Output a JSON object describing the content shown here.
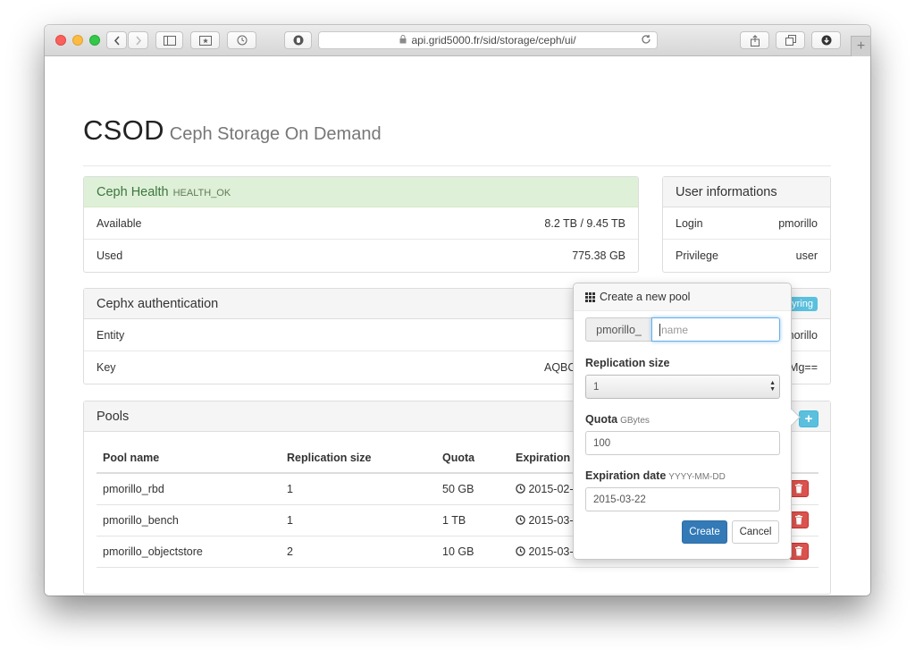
{
  "browser": {
    "url": "api.grid5000.fr/sid/storage/ceph/ui/"
  },
  "brand": {
    "title": "CSOD",
    "subtitle": "Ceph Storage On Demand"
  },
  "health": {
    "title": "Ceph Health",
    "status": "HEALTH_OK",
    "rows": [
      {
        "label": "Available",
        "value": "8.2 TB / 9.45 TB"
      },
      {
        "label": "Used",
        "value": "775.38 GB"
      }
    ]
  },
  "user": {
    "title": "User informations",
    "rows": [
      {
        "label": "Login",
        "value": "pmorillo"
      },
      {
        "label": "Privilege",
        "value": "user"
      }
    ]
  },
  "cephx": {
    "title": "Cephx authentication",
    "badge": "eyring",
    "rows": [
      {
        "label": "Entity",
        "value_start": "",
        "value_end": "norillo"
      },
      {
        "label": "Key",
        "value_start": "AQBC",
        "value_end": "Mg=="
      }
    ]
  },
  "pools": {
    "title": "Pools",
    "columns": [
      "Pool name",
      "Replication size",
      "Quota",
      "Expiration"
    ],
    "rows": [
      {
        "name": "pmorillo_rbd",
        "replication": "1",
        "quota": "50 GB",
        "expiration": "2015-02-"
      },
      {
        "name": "pmorillo_bench",
        "replication": "1",
        "quota": "1 TB",
        "expiration": "2015-03-"
      },
      {
        "name": "pmorillo_objectstore",
        "replication": "2",
        "quota": "10 GB",
        "expiration": "2015-03-"
      }
    ]
  },
  "popover": {
    "title": "Create a new pool",
    "prefix": "pmorillo_",
    "name_placeholder": "name",
    "replication_label": "Replication size",
    "replication_value": "1",
    "quota_label": "Quota",
    "quota_unit": "GBytes",
    "quota_value": "100",
    "expiration_label": "Expiration date",
    "expiration_format": "YYYY-MM-DD",
    "expiration_value": "2015-03-22",
    "create_label": "Create",
    "cancel_label": "Cancel"
  },
  "colors": {
    "success_bg": "#dff0d8",
    "info": "#5bc0de",
    "danger": "#d9534f",
    "primary": "#337ab7"
  }
}
